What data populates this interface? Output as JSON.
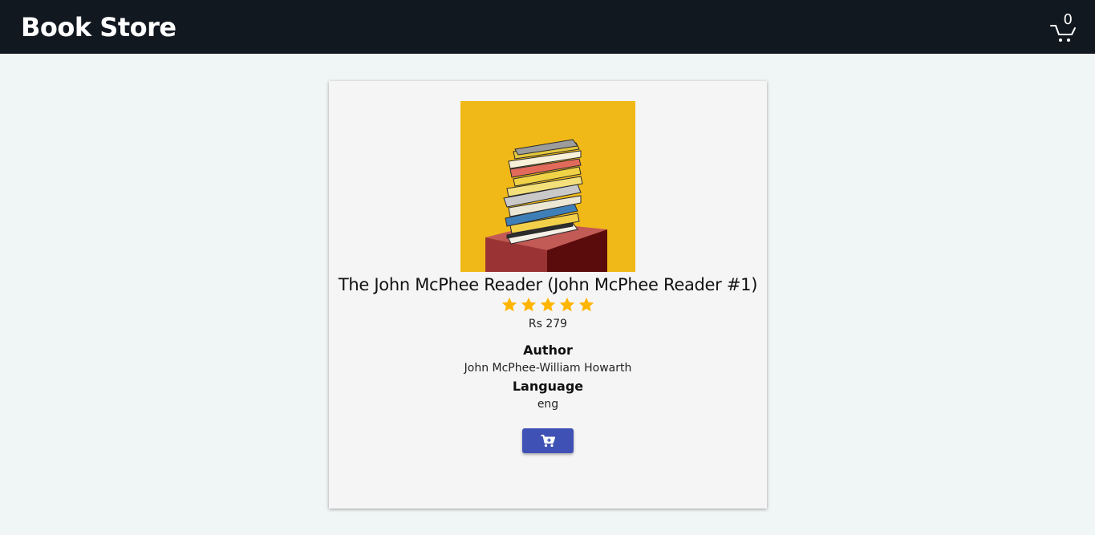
{
  "header": {
    "brand": "Book Store",
    "cart_count": "0",
    "cart_icon": "shopping-cart-icon"
  },
  "book": {
    "cover_icon": "book-stack-image",
    "title": "The John McPhee Reader (John McPhee Reader #1)",
    "rating": 5,
    "rating_max": 5,
    "price": "Rs 279",
    "author_label": "Author",
    "author": "John McPhee-William Howarth",
    "language_label": "Language",
    "language": "eng",
    "add_to_cart_icon": "add-to-cart-icon"
  },
  "colors": {
    "navbar": "#121820",
    "background": "#f0f5f5",
    "card": "#f5f5f5",
    "star": "#ffb400",
    "button": "#3f51b5",
    "cover_bg": "#f1b918"
  }
}
